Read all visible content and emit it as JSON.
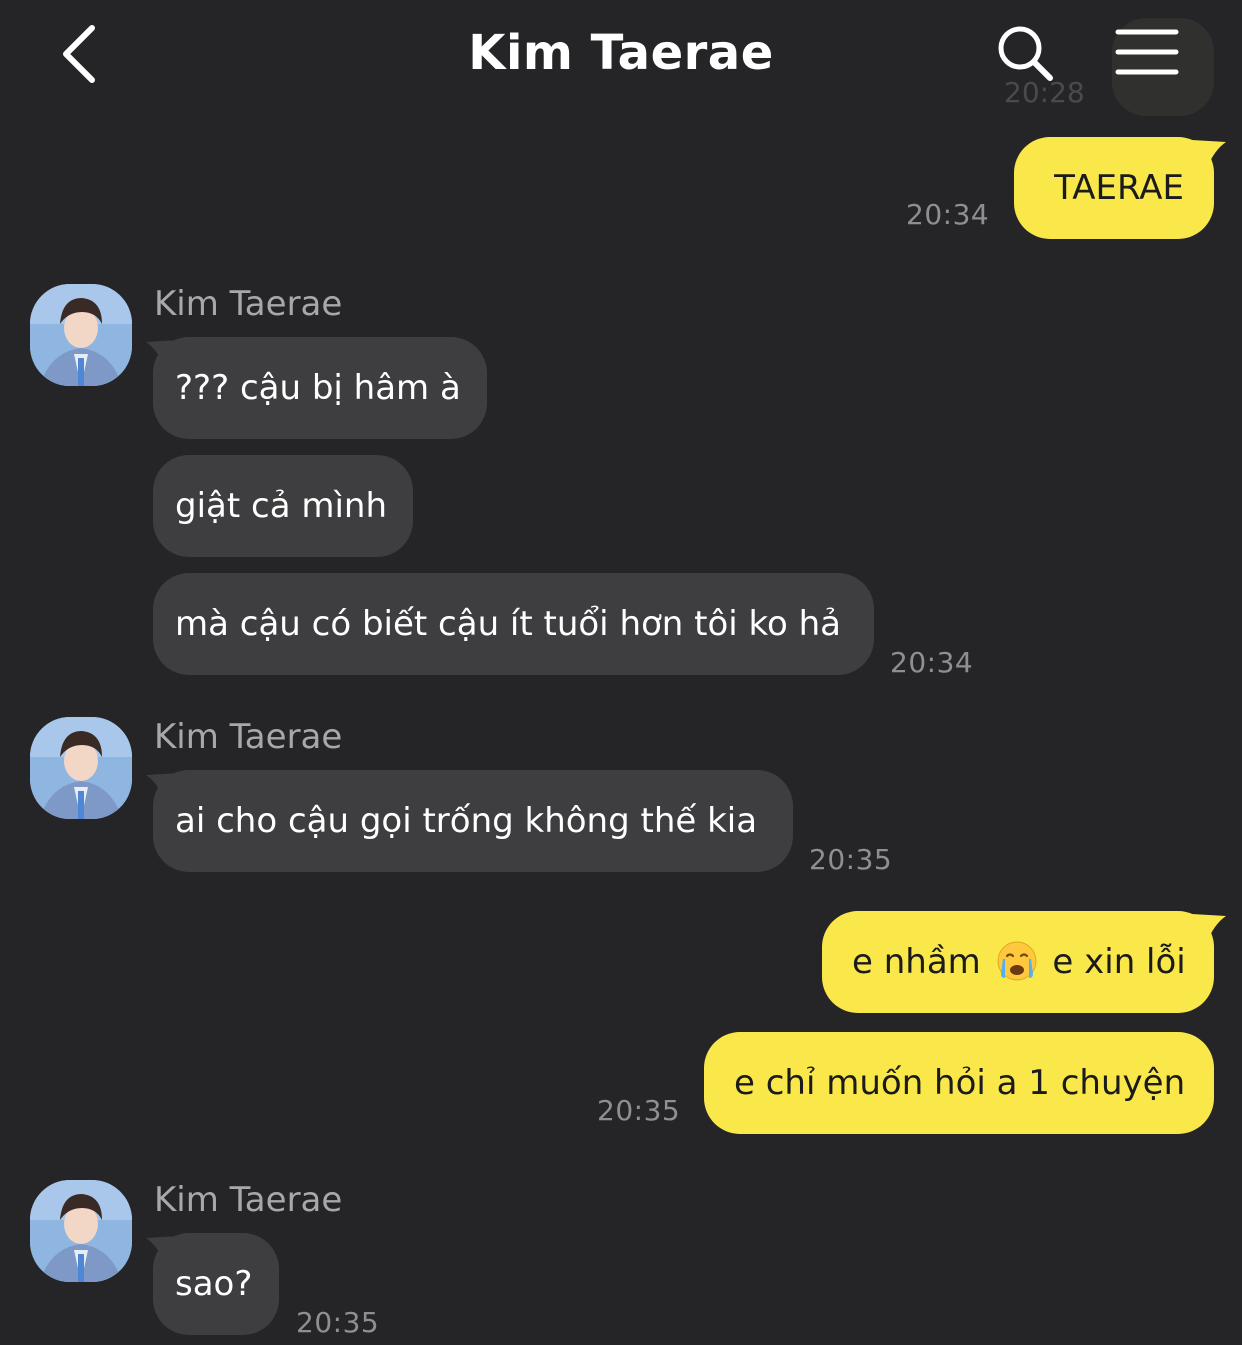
{
  "header": {
    "title": "Kim Taerae",
    "back_icon": "chevron-left-icon",
    "search_icon": "search-icon",
    "menu_icon": "menu-icon"
  },
  "ghost_time": "20:28",
  "messages": [
    {
      "side": "out",
      "text": "TAERAE",
      "time": "20:34"
    },
    {
      "side": "in",
      "sender": "Kim Taerae",
      "text": "??? cậu bị hâm à"
    },
    {
      "side": "in",
      "text": "giật cả mình"
    },
    {
      "side": "in",
      "text": "mà cậu có biết cậu ít tuổi hơn tôi ko hả",
      "time": "20:34"
    },
    {
      "side": "in",
      "sender": "Kim Taerae",
      "text": "ai cho cậu gọi trống không thế kia",
      "time": "20:35"
    },
    {
      "side": "out",
      "text_before": "e nhầm",
      "emoji": "crying-face-emoji",
      "text_after": "e xin lỗi"
    },
    {
      "side": "out",
      "text": "e chỉ muốn hỏi a 1 chuyện",
      "time": "20:35"
    },
    {
      "side": "in",
      "sender": "Kim Taerae",
      "text": "sao?",
      "time": "20:35"
    }
  ],
  "colors": {
    "background": "#252527",
    "incoming_bubble": "#3e3e40",
    "outgoing_bubble": "#fae84a",
    "timestamp": "#8e8e93",
    "sender_name": "#a7a7ac"
  }
}
